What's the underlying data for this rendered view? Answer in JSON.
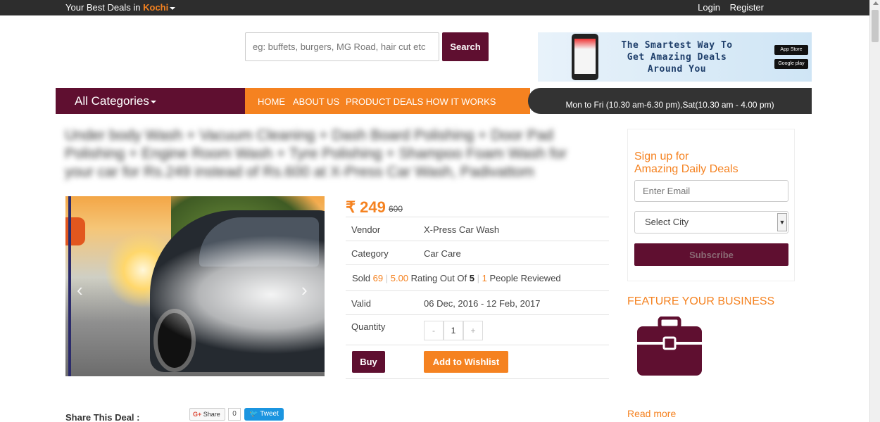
{
  "topbar": {
    "location_prefix": "Your Best Deals in",
    "city": "Kochi",
    "login": "Login",
    "register": "Register"
  },
  "search": {
    "placeholder": "eg: buffets, burgers, MG Road, hair cut etc",
    "button": "Search"
  },
  "banner": {
    "tagline": "The Smartest Way To Get Amazing Deals Around You",
    "app_store": "App Store",
    "google_play": "Google play"
  },
  "nav": {
    "categories": "All Categories",
    "items": [
      "HOME",
      "ABOUT US",
      "PRODUCT DEALS",
      "HOW IT WORKS"
    ],
    "hours": "Mon to Fri (10.30 am-6.30 pm),Sat(10.30 am - 4.00 pm)"
  },
  "deal": {
    "title": "Under body Wash + Vacuum Cleaning + Dash Board Polishing + Door Pad Polishing + Engine Room Wash + Tyre Polishing + Shampoo Foam Wash for your car for Rs.249 instead of Rs.600 at X-Press Car Wash, Padivattom",
    "price": "₹ 249",
    "old_price": "600",
    "vendor_label": "Vendor",
    "vendor": "X-Press Car Wash",
    "category_label": "Category",
    "category": "Car Care",
    "sold_label": "Sold",
    "sold": "69",
    "rating": "5.00",
    "rating_text": "Rating Out Of",
    "rating_max": "5",
    "reviewed": "1",
    "reviewed_text": "People Reviewed",
    "valid_label": "Valid",
    "valid": "06 Dec, 2016 - 12 Feb, 2017",
    "quantity_label": "Quantity",
    "qty_minus": "-",
    "qty": "1",
    "qty_plus": "+",
    "buy": "Buy",
    "wishlist": "Add to Wishlist"
  },
  "share": {
    "label": "Share This Deal :",
    "gplus": "G+",
    "gplus_label": "Share",
    "gplus_count": "0",
    "tweet": "Tweet"
  },
  "signup": {
    "heading_line1": "Sign up for",
    "heading_line2": "Amazing Daily Deals",
    "email_placeholder": "Enter Email",
    "city_select": "Select City",
    "subscribe": "Subscribe"
  },
  "feature": {
    "title": "FEATURE YOUR BUSINESS",
    "read_more": "Read more"
  },
  "colors": {
    "brand_maroon": "#5f0f30",
    "accent_orange": "#f58220",
    "topbar": "#2d2d2d"
  }
}
